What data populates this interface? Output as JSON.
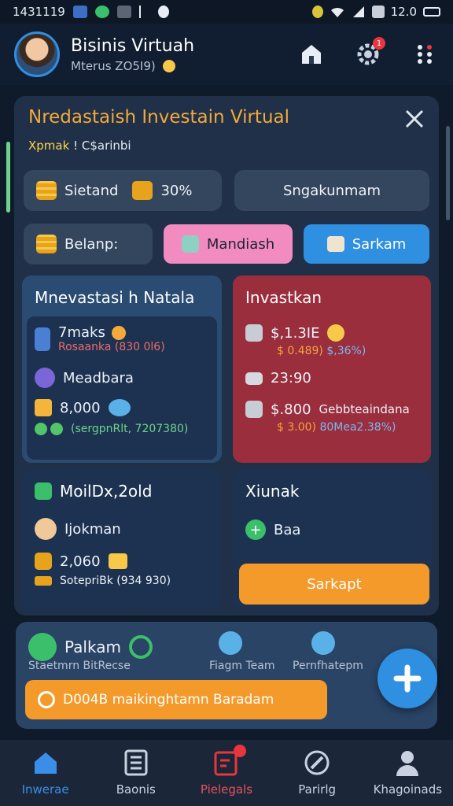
{
  "status_bar": {
    "time": "1431119",
    "battery": "12.0"
  },
  "header": {
    "title": "Bisinis Virtuah",
    "subtitle": "Mterus ZO5I9)",
    "notification_count": "1"
  },
  "panel": {
    "title": "Nredastaish Investain Virtual",
    "subtitle_accent": "Xpmak",
    "subtitle_text": "! C$arinbi",
    "pill1": {
      "label": "Sietand",
      "value": "30%"
    },
    "pill2_label": "Sngakunmam",
    "pill3_label": "Belanp:",
    "button_pink": "Mandiash",
    "button_blue": "Sarkam"
  },
  "card_invest": {
    "title": "Mnevastasi h Natala",
    "item1_name": "7maks",
    "item1_detail": "Rosaanka (830 0l6)",
    "item2_name": "Meadbara",
    "item3_value": "8,000",
    "item3_detail": "(sergpnRlt, 7207380)"
  },
  "card_right": {
    "title": "Invastkan",
    "row1_value": "$,1.3IE",
    "row1_detail_a": "$ 0.489)",
    "row1_detail_b": "$,36%)",
    "row2_value": "23:90",
    "row3_value": "$.800",
    "row3_extra": "Gebbteaindana",
    "row3_detail_a": "$ 3.00)",
    "row3_detail_b": "80Mea2.38%)"
  },
  "card_mobile": {
    "title": "MoilDx,2old",
    "item1": "Ijokman",
    "item2_value": "2,060",
    "item2_detail": "SotepriBk (934 930)"
  },
  "card_small": {
    "title": "Xiunak",
    "item": "Baa",
    "button": "Sarkapt"
  },
  "bottom_card": {
    "title": "Palkam",
    "label1": "Staetmrn BitRecse",
    "label2": "Fiagm Team",
    "label3": "Pernfhatepm",
    "banner": "D004B maikinghtamn Baradam"
  },
  "tabs": [
    {
      "label": "Inwerae"
    },
    {
      "label": "Baonis"
    },
    {
      "label": "Pielegals"
    },
    {
      "label": "Parirlg"
    },
    {
      "label": "Khagoinads"
    }
  ],
  "colors": {
    "accent_orange": "#f3a93c",
    "pink": "#f28cc0",
    "blue": "#2f8fe0",
    "red_card": "#9a2e3d",
    "active_tab": "#3a8ee8"
  }
}
